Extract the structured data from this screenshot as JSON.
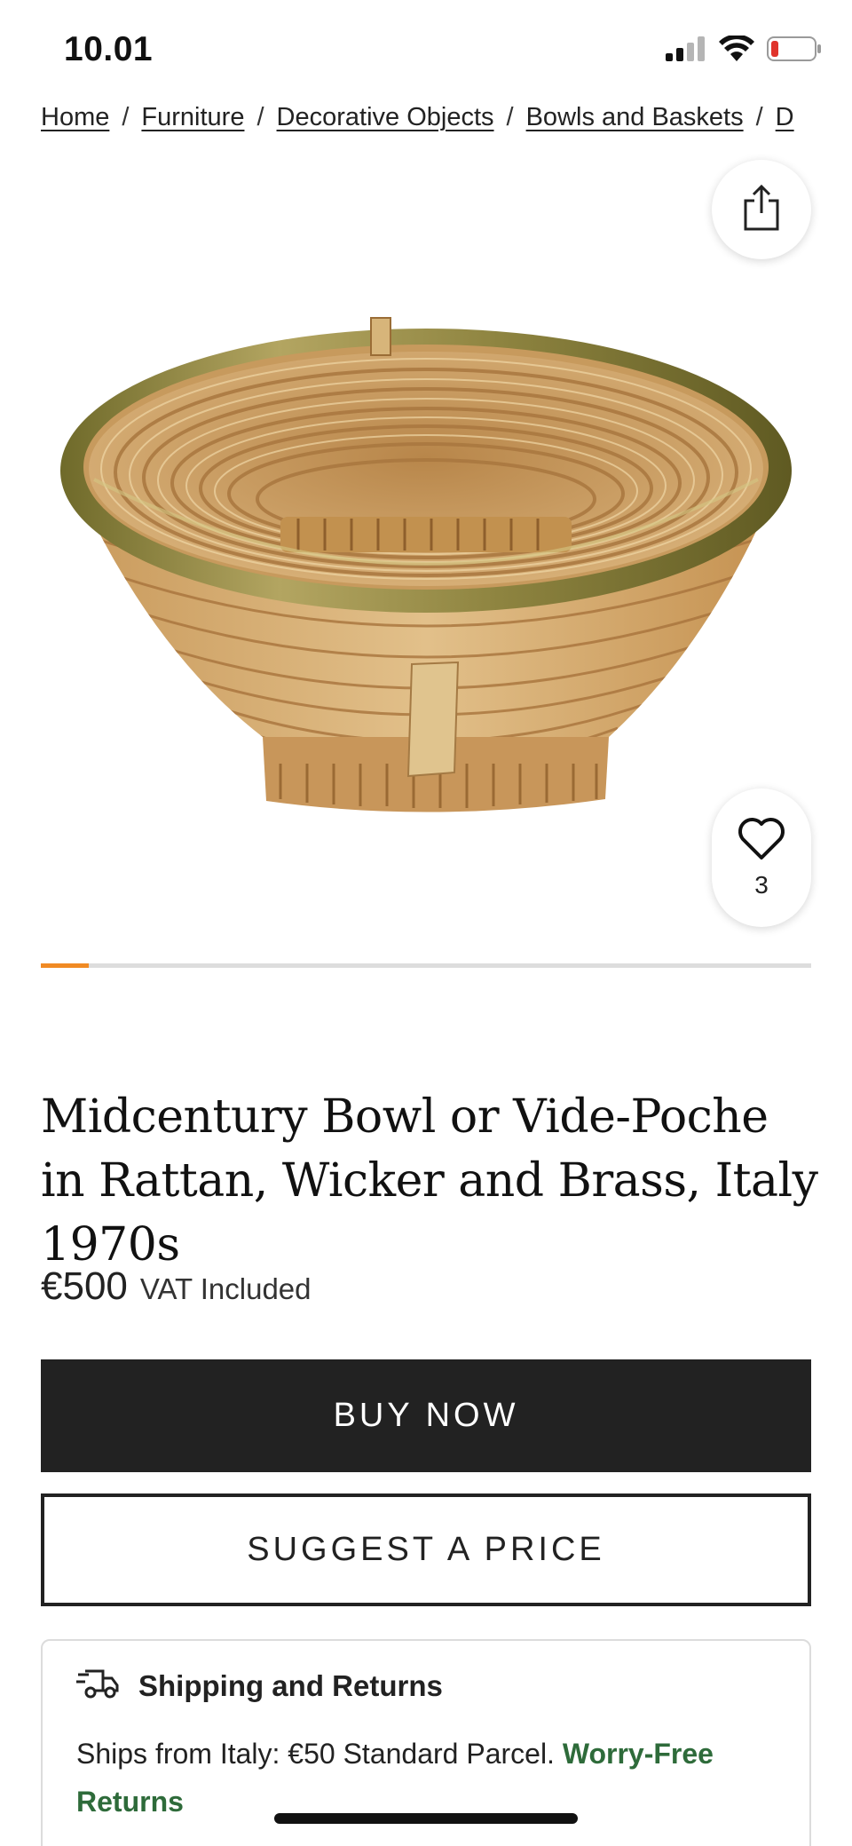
{
  "status_bar": {
    "time": "10.01",
    "icons": [
      "cellular-signal-icon",
      "wifi-icon",
      "battery-low-icon"
    ]
  },
  "breadcrumb": [
    {
      "label": "Home"
    },
    {
      "label": "Furniture"
    },
    {
      "label": "Decorative Objects"
    },
    {
      "label": "Bowls and Baskets"
    },
    {
      "label": "D"
    }
  ],
  "breadcrumb_separator": "/",
  "share": {
    "icon": "share-icon"
  },
  "favorite": {
    "icon": "heart-icon",
    "count": "3"
  },
  "carousel": {
    "progress": 0.0625,
    "progress_color": "#f08a24"
  },
  "product": {
    "title": "Midcentury Bowl or Vide-Poche in Rattan, Wicker and Brass, Italy 1970s",
    "price": "€500",
    "vat_note": "VAT Included"
  },
  "actions": {
    "buy_label": "BUY NOW",
    "suggest_label": "SUGGEST A PRICE"
  },
  "shipping": {
    "icon": "delivery-truck-icon",
    "title": "Shipping and Returns",
    "text": "Ships from Italy: €50 Standard Parcel.",
    "link": "Worry-Free Returns",
    "link_color": "#2e6b3a"
  }
}
